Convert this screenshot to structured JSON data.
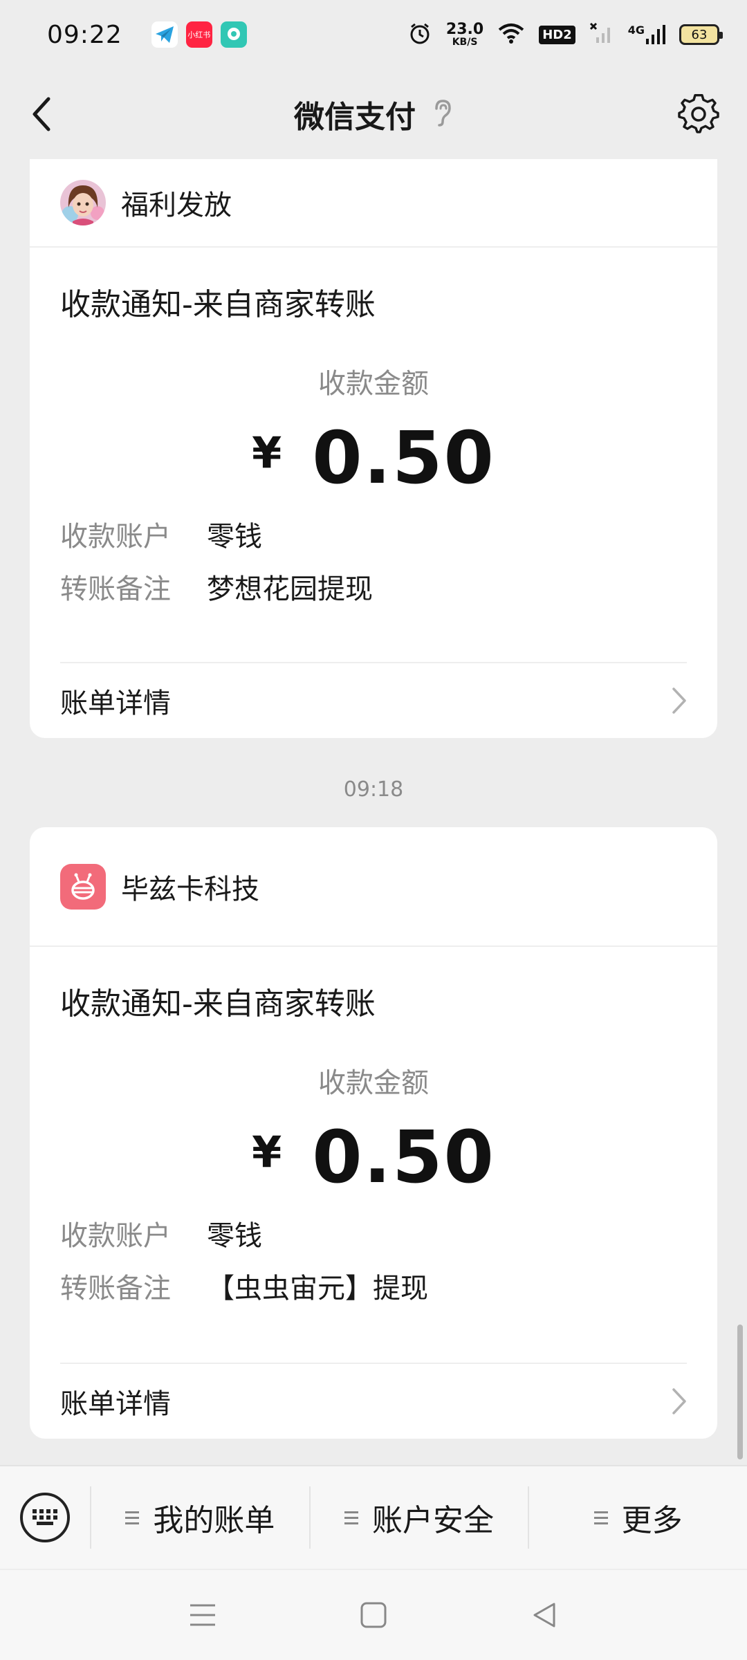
{
  "status_bar": {
    "time": "09:22",
    "app_icons": [
      "telegram-icon",
      "xiaohongshu-icon",
      "message-app-icon"
    ],
    "xiaohongshu_text": "小红书",
    "net_speed": "23.0",
    "net_speed_unit": "KB/S",
    "hd_badge": "HD2",
    "network": "4G",
    "battery": "63"
  },
  "nav": {
    "title": "微信支付"
  },
  "cards": [
    {
      "merchant": "福利发放",
      "title": "收款通知-来自商家转账",
      "amount_label": "收款金额",
      "currency": "¥",
      "amount": "0.50",
      "account_key": "收款账户",
      "account_value": "零钱",
      "note_key": "转账备注",
      "note_value": "梦想花园提现",
      "detail_label": "账单详情"
    },
    {
      "merchant": "毕兹卡科技",
      "title": "收款通知-来自商家转账",
      "amount_label": "收款金额",
      "currency": "¥",
      "amount": "0.50",
      "account_key": "收款账户",
      "account_value": "零钱",
      "note_key": "转账备注",
      "note_value": "【虫虫宙元】提现",
      "detail_label": "账单详情"
    }
  ],
  "timestamp": "09:18",
  "bottom_menu": {
    "items": [
      "我的账单",
      "账户安全",
      "更多"
    ]
  },
  "colors": {
    "background": "#ededed",
    "card": "#ffffff",
    "secondary_text": "#8a8a8a",
    "merchant2_icon": "#f26b7a"
  }
}
